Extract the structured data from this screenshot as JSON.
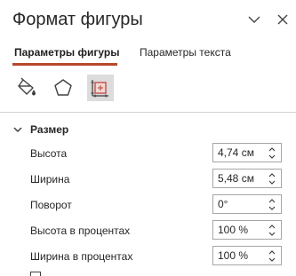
{
  "pane": {
    "title": "Формат фигуры",
    "icons": {
      "menu": "chevron-down-icon",
      "close": "close-icon"
    }
  },
  "tabs": [
    {
      "label": "Параметры фигуры",
      "selected": true
    },
    {
      "label": "Параметры текста",
      "selected": false
    }
  ],
  "accent_color": "#b7472a",
  "category_icons": [
    {
      "name": "fill-line-icon",
      "selected": false
    },
    {
      "name": "effects-pentagon-icon",
      "selected": false
    },
    {
      "name": "size-properties-icon",
      "selected": true
    }
  ],
  "size_section": {
    "title": "Размер",
    "expanded": true,
    "fields": [
      {
        "label": "Высота",
        "value": "4,74 см"
      },
      {
        "label": "Ширина",
        "value": "5,48 см"
      },
      {
        "label": "Поворот",
        "value": "0°"
      },
      {
        "label": "Высота в процентах",
        "value": "100 %"
      },
      {
        "label": "Ширина в процентах",
        "value": "100 %"
      }
    ]
  }
}
